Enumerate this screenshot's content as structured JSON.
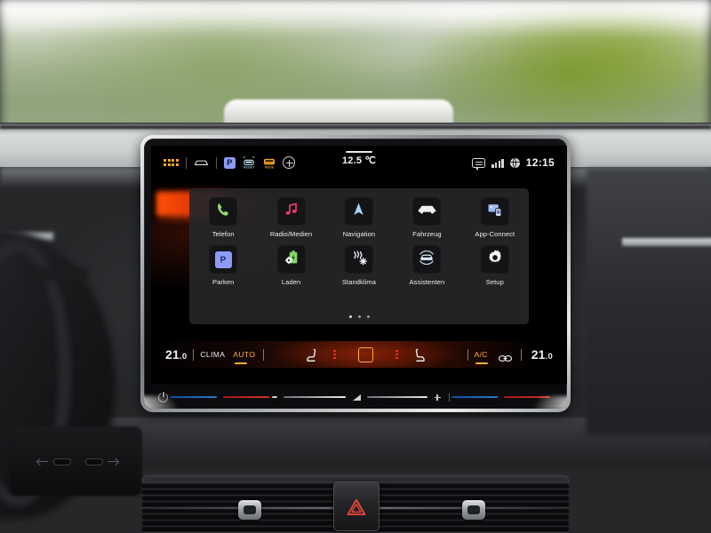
{
  "scene": {
    "description": "Car interior dashboard with central infotainment touchscreen",
    "hazard_button": "hazard-warning-triangle",
    "usb_ports": [
      "usb-c-port-left",
      "usb-c-port-right"
    ]
  },
  "status_bar": {
    "left_icons": [
      {
        "name": "app-grid-icon",
        "label": "Apps"
      },
      {
        "name": "vehicle-icon",
        "label": "Fahrzeug"
      },
      {
        "name": "parking-badge-icon",
        "label": "P"
      },
      {
        "name": "assist-icon",
        "label": "ASSIST"
      },
      {
        "name": "drive-mode-icon",
        "label": "MODE"
      },
      {
        "name": "add-shortcut-icon",
        "label": "+"
      }
    ],
    "outside_temperature": "12.5 ℃",
    "right_icons": [
      {
        "name": "message-icon"
      },
      {
        "name": "signal-bars-icon"
      },
      {
        "name": "connectivity-globe-icon"
      }
    ],
    "clock": "12:15"
  },
  "app_grid": {
    "rows": [
      [
        {
          "label": "Telefon",
          "icon": "phone-icon",
          "color": "#8fdc6e"
        },
        {
          "label": "Radio/Medien",
          "icon": "music-note-icon",
          "color": "#f03a6b"
        },
        {
          "label": "Navigation",
          "icon": "navigation-arrow-icon",
          "color": "#a6d4f2"
        },
        {
          "label": "Fahrzeug",
          "icon": "car-icon",
          "color": "#f0f0f0"
        },
        {
          "label": "App-Connect",
          "icon": "app-connect-icon",
          "color": "#9fb8ef"
        }
      ],
      [
        {
          "label": "Parken",
          "icon": "parking-p-icon",
          "color": "#8e9bf5"
        },
        {
          "label": "Laden",
          "icon": "charging-battery-icon",
          "color": "#86d46a"
        },
        {
          "label": "Standklima",
          "icon": "standklima-icon",
          "color": "#e6eef8"
        },
        {
          "label": "Assistenten",
          "icon": "assistants-icon",
          "color": "#bfe3f5"
        },
        {
          "label": "Setup",
          "icon": "gear-icon",
          "color": "#f2f2f2"
        }
      ]
    ],
    "page_indicator": {
      "total": 3,
      "active": 1
    }
  },
  "climate_bar": {
    "temp_left": "21.0",
    "temp_left_main": "21",
    "temp_left_dec": ".0",
    "clima_label": "CLIMA",
    "auto_label": "AUTO",
    "ac_label": "A/C",
    "temp_right_main": "21",
    "temp_right_dec": ".0",
    "icons": [
      {
        "name": "seat-heating-left-icon"
      },
      {
        "name": "heat-level-left-icon"
      },
      {
        "name": "climate-center-button"
      },
      {
        "name": "heat-level-right-icon"
      },
      {
        "name": "seat-heating-right-icon"
      },
      {
        "name": "steering-wheel-heating-icon"
      }
    ]
  },
  "slider_strip": {
    "power_button": "power-icon",
    "left_temp_slider": "driver-temperature-slider",
    "volume_slider": "volume-slider",
    "volume_minus": "−",
    "volume_plus": "+",
    "right_temp_slider": "passenger-temperature-slider"
  },
  "colors": {
    "accent_amber": "#ffb03a",
    "accent_orange": "#ff4d08",
    "panel_bg": "#262629",
    "tile_bg": "#141416"
  }
}
